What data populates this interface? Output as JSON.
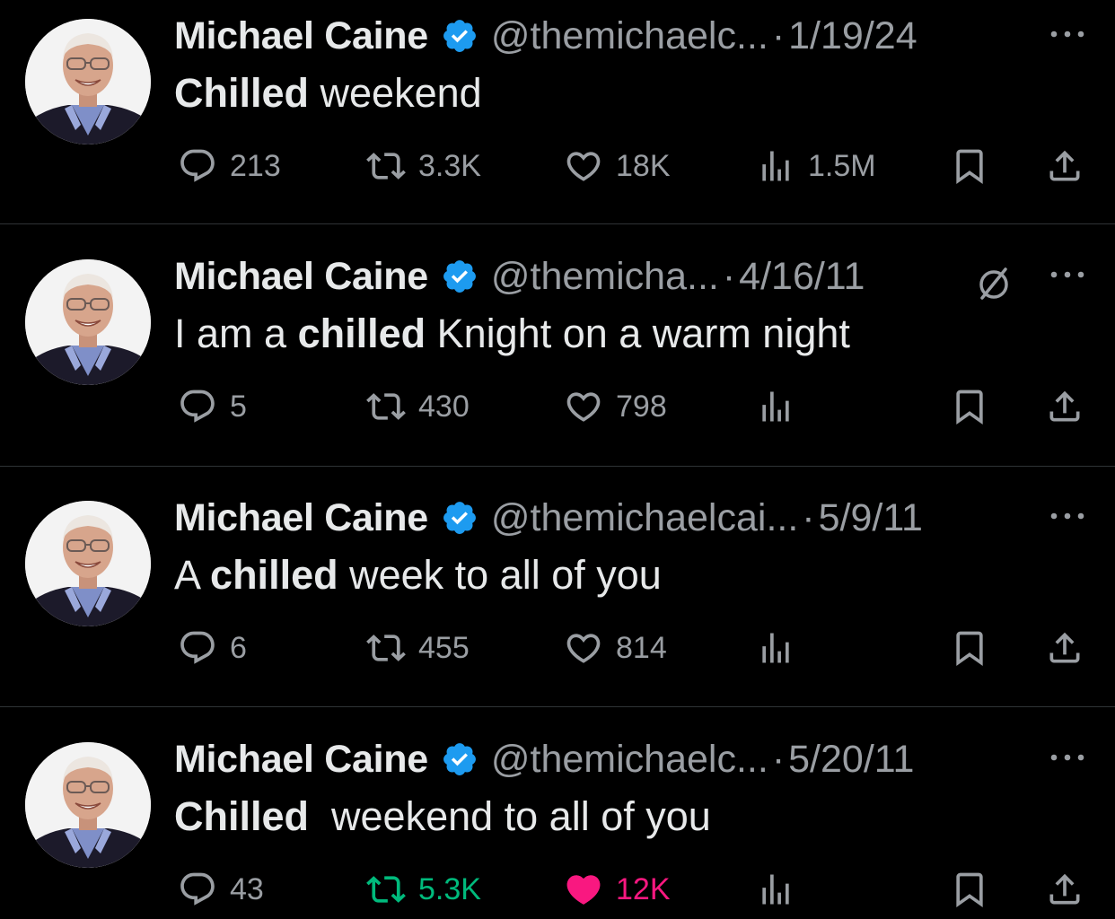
{
  "tweets": [
    {
      "name": "Michael Caine",
      "handle": "@themichaelc...",
      "date": "1/19/24",
      "text_parts": [
        {
          "text": "Chilled",
          "bold": true
        },
        {
          "text": " weekend",
          "bold": false
        }
      ],
      "replies": "213",
      "retweets": "3.3K",
      "likes": "18K",
      "views": "1.5M",
      "retweeted": false,
      "liked": false,
      "muted_conversation_icon": false
    },
    {
      "name": "Michael Caine",
      "handle": "@themicha...",
      "date": "4/16/11",
      "text_parts": [
        {
          "text": "I am a ",
          "bold": false
        },
        {
          "text": "chilled",
          "bold": true
        },
        {
          "text": " Knight on a warm night",
          "bold": false
        }
      ],
      "replies": "5",
      "retweets": "430",
      "likes": "798",
      "views": "",
      "retweeted": false,
      "liked": false,
      "muted_conversation_icon": true
    },
    {
      "name": "Michael Caine",
      "handle": "@themichaelcai...",
      "date": "5/9/11",
      "text_parts": [
        {
          "text": "A ",
          "bold": false
        },
        {
          "text": "chilled",
          "bold": true
        },
        {
          "text": " week to all of you",
          "bold": false
        }
      ],
      "replies": "6",
      "retweets": "455",
      "likes": "814",
      "views": "",
      "retweeted": false,
      "liked": false,
      "muted_conversation_icon": false
    },
    {
      "name": "Michael Caine",
      "handle": "@themichaelc...",
      "date": "5/20/11",
      "text_parts": [
        {
          "text": "Chilled",
          "bold": true
        },
        {
          "text": "  weekend to all of you",
          "bold": false
        }
      ],
      "replies": "43",
      "retweets": "5.3K",
      "likes": "12K",
      "views": "",
      "retweeted": true,
      "liked": true,
      "muted_conversation_icon": false
    }
  ],
  "dot_separator": "·",
  "colors": {
    "background": "#000000",
    "text": "#e7e9ea",
    "secondary_text": "#9a9ea3",
    "verified": "#1d9bf0",
    "retweet_active": "#00ba7c",
    "like_active": "#f91880",
    "divider": "#2f3336"
  },
  "icons": {
    "reply": "speech-bubble-icon",
    "retweet": "retweet-arrows-icon",
    "like": "heart-icon",
    "views": "bar-chart-icon",
    "bookmark": "bookmark-icon",
    "share": "share-upload-icon",
    "more": "ellipsis-icon",
    "verified": "verified-badge-icon",
    "muted": "circle-slash-icon"
  }
}
